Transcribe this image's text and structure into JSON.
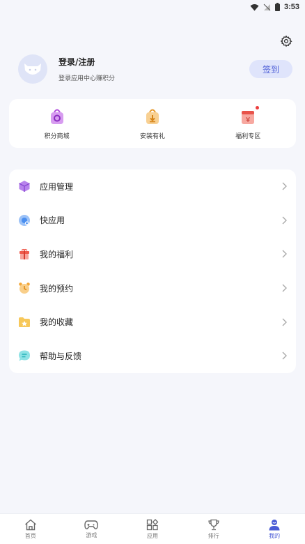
{
  "status_bar": {
    "time": "3:53"
  },
  "profile": {
    "title": "登录/注册",
    "subtitle": "登录应用中心赚积分",
    "checkin_label": "签到"
  },
  "quick": [
    {
      "label": "积分商城",
      "icon": "points-mall-icon",
      "color": "#b04bdc",
      "badge": false
    },
    {
      "label": "安装有礼",
      "icon": "install-gift-icon",
      "color": "#f0a534",
      "badge": false
    },
    {
      "label": "福利专区",
      "icon": "welfare-zone-icon",
      "color": "#e8534a",
      "badge": true
    }
  ],
  "menu": [
    {
      "label": "应用管理",
      "icon": "app-manage-icon",
      "color": "#a45fe0"
    },
    {
      "label": "快应用",
      "icon": "quick-app-icon",
      "color": "#4a8ff0"
    },
    {
      "label": "我的福利",
      "icon": "gift-icon",
      "color": "#ef5a4c"
    },
    {
      "label": "我的预约",
      "icon": "alarm-clock-icon",
      "color": "#f4a83a"
    },
    {
      "label": "我的收藏",
      "icon": "favorite-folder-icon",
      "color": "#f5b833"
    },
    {
      "label": "帮助与反馈",
      "icon": "help-feedback-icon",
      "color": "#3dc9cf"
    }
  ],
  "nav": [
    {
      "label": "首页",
      "icon": "home-icon",
      "active": false
    },
    {
      "label": "游戏",
      "icon": "gamepad-icon",
      "active": false
    },
    {
      "label": "应用",
      "icon": "apps-icon",
      "active": false
    },
    {
      "label": "排行",
      "icon": "trophy-icon",
      "active": false
    },
    {
      "label": "我的",
      "icon": "user-icon",
      "active": true
    }
  ],
  "colors": {
    "accent": "#4a5bd6",
    "background": "#f5f6fb"
  }
}
